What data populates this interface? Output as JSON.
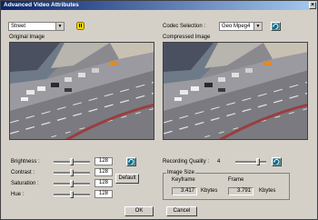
{
  "window": {
    "title": "Advanced Video Attributes",
    "close_glyph": "×"
  },
  "source_select": {
    "value": "Street"
  },
  "codec": {
    "label": "Codec Selection :",
    "value": "Geo Mpeg4"
  },
  "original_image": {
    "label": "Original Image"
  },
  "compressed_image": {
    "label": "Compressed Image"
  },
  "controls": [
    {
      "label": "Brightness :",
      "value": "128",
      "level": 0.5
    },
    {
      "label": "Contrast :",
      "value": "128",
      "level": 0.5
    },
    {
      "label": "Saturation :",
      "value": "128",
      "level": 0.5
    },
    {
      "label": "Hue :",
      "value": "128",
      "level": 0.5
    }
  ],
  "default_button": "Default",
  "recording_quality": {
    "label": "Recording Quality :",
    "value": "4",
    "level": 0.75
  },
  "image_size": {
    "title": "Image Size",
    "keyframe_label": "Keyframe",
    "frame_label": "Frame",
    "keyframe_value": "3.417",
    "frame_value": "3.791",
    "unit_keyframe": "Kbytes",
    "unit_frame": "Kbytes"
  },
  "buttons": {
    "ok": "OK",
    "cancel": "Cancel"
  },
  "colors": {
    "title_start": "#0a246a",
    "title_end": "#a6caf0",
    "face": "#d4d0c8"
  }
}
